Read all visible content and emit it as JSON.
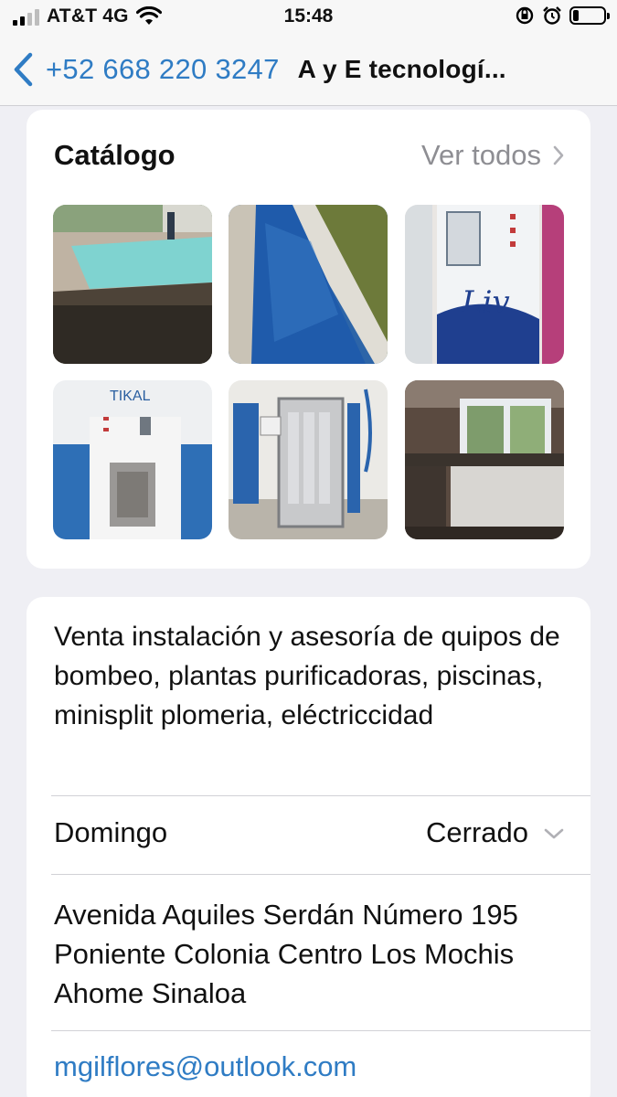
{
  "status_bar": {
    "carrier": "AT&T 4G",
    "time": "15:48",
    "battery_level": 0.2
  },
  "nav": {
    "back_label": "+52 668 220 3247",
    "title": "A y E tecnologí..."
  },
  "catalog": {
    "title": "Catálogo",
    "see_all": "Ver todos",
    "items": [
      {
        "image": "outdoor-pool-under-construction"
      },
      {
        "image": "blue-pool-edge"
      },
      {
        "image": "water-vending-machine"
      },
      {
        "image": "tikal-water-dispenser"
      },
      {
        "image": "reverse-osmosis-purification-equipment"
      },
      {
        "image": "purification-plant-room"
      }
    ]
  },
  "info": {
    "description": "Venta instalación y asesoría de quipos de bombeo, plantas purificadoras, piscinas, minisplit plomeria, eléctriccidad",
    "hours_day": "Domingo",
    "hours_status": "Cerrado",
    "address": "Avenida Aquiles Serdán Número 195 Poniente Colonia Centro Los Mochis Ahome Sinaloa",
    "email": "mgilflores@outlook.com"
  },
  "colors": {
    "link": "#2f7cc4",
    "secondary_text": "#8e8e93",
    "background": "#efeff4"
  }
}
